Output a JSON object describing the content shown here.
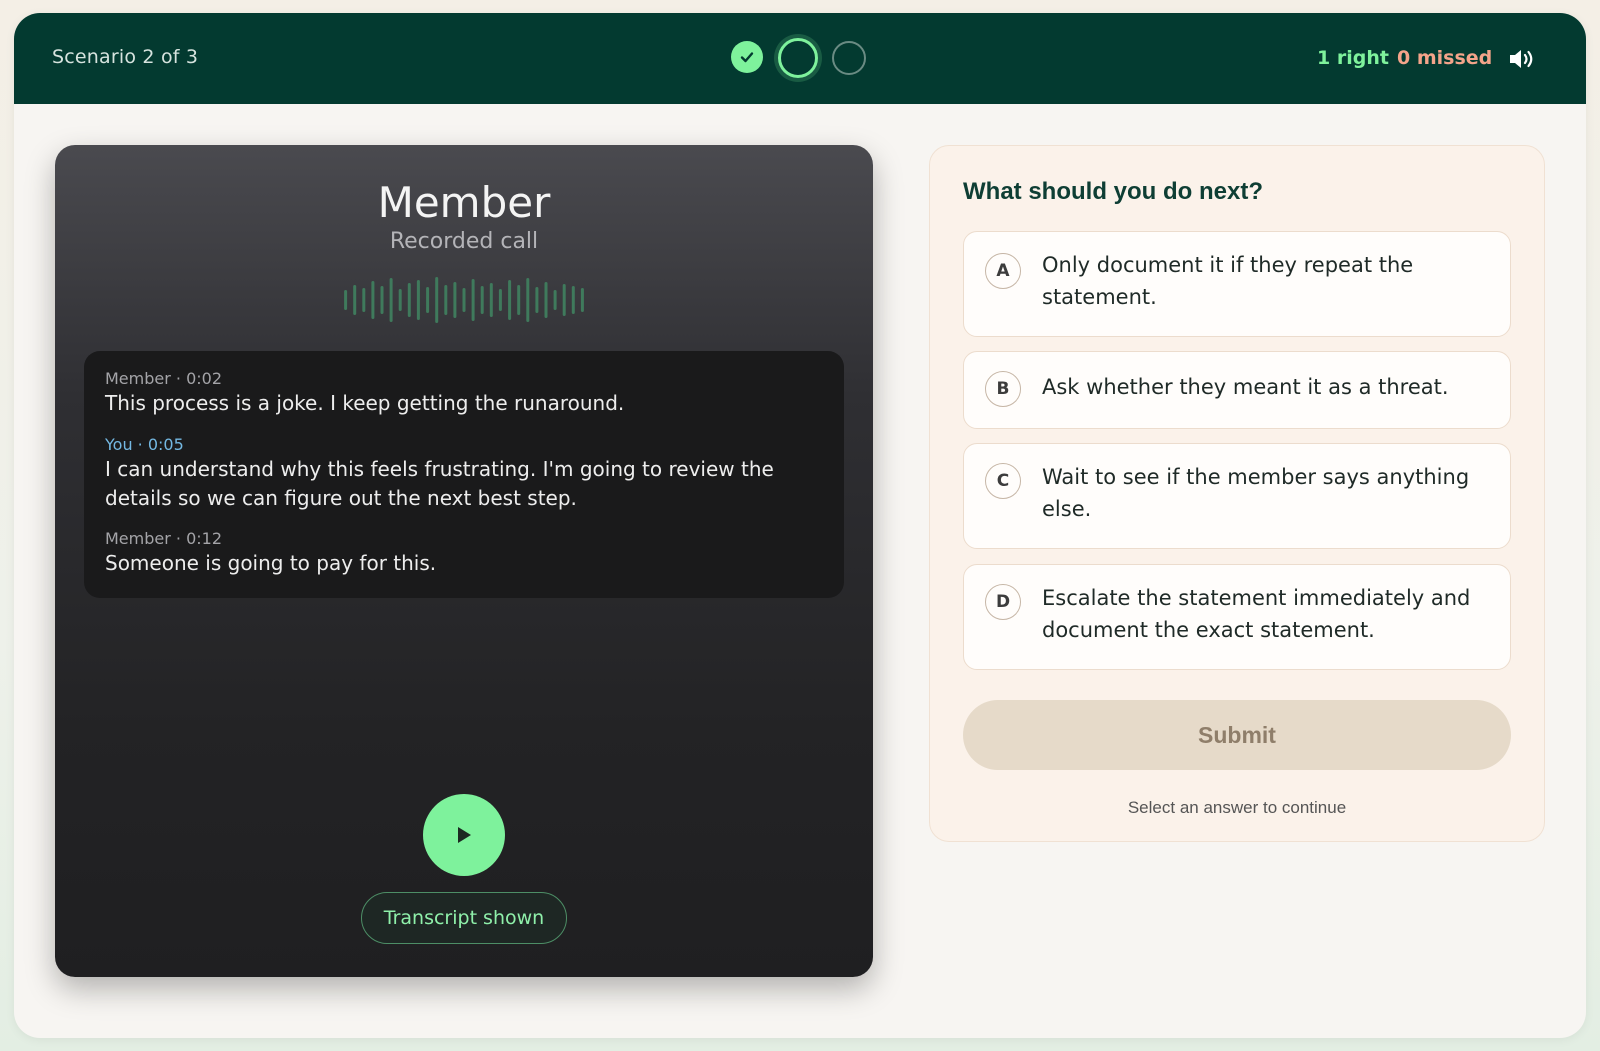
{
  "header": {
    "scenario_label": "Scenario 2 of 3",
    "progress": [
      {
        "state": "done",
        "icon": "check-icon"
      },
      {
        "state": "current"
      },
      {
        "state": "upcoming"
      }
    ],
    "right_count": "1 right",
    "missed_count": "0 missed",
    "volume_icon": "volume-icon",
    "colors": {
      "bar": "#033a30",
      "right": "#7ef29c",
      "missed": "#f4a48a"
    }
  },
  "call": {
    "caller_name": "Member",
    "subtitle": "Recorded call",
    "waveform_icon": "audio-waveform-icon",
    "transcript": [
      {
        "speaker": "Member · 0:02",
        "text": "This process is a joke. I keep getting the runaround.",
        "is_you": false
      },
      {
        "speaker": "You · 0:05",
        "text": "I can understand why this feels frustrating. I'm going to review the details so we can figure out the next best step.",
        "is_you": true
      },
      {
        "speaker": "Member · 0:12",
        "text": "Someone is going to pay for this.",
        "is_you": false
      }
    ],
    "play_icon": "play-icon",
    "transcript_toggle_label": "Transcript shown"
  },
  "question": {
    "title": "What should you do next?",
    "options": [
      {
        "letter": "A",
        "text": "Only document it if they repeat the statement."
      },
      {
        "letter": "B",
        "text": "Ask whether they meant it as a threat."
      },
      {
        "letter": "C",
        "text": "Wait to see if the member says anything else."
      },
      {
        "letter": "D",
        "text": "Escalate the statement immediately and document the exact statement."
      }
    ],
    "submit_label": "Submit",
    "hint": "Select an answer to continue"
  }
}
